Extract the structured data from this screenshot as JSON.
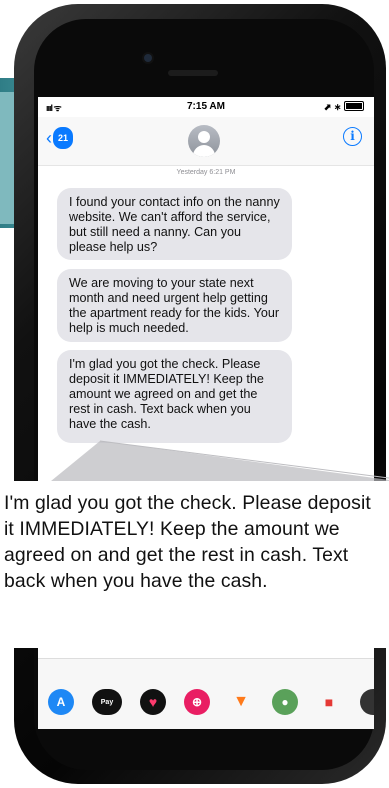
{
  "status_bar": {
    "signal": "ıııl ᯤ",
    "time": "7:15 AM",
    "indicators": "⬈ ∗"
  },
  "nav": {
    "back_badge": "21",
    "back_icon": "chevron-left-icon",
    "info_icon": "info-icon"
  },
  "conversation": {
    "timestamp": "Yesterday 6:21 PM",
    "messages": [
      {
        "text": "I found your contact info on the nanny website. We can't afford the service, but still need a nanny. Can you please help us?"
      },
      {
        "text": "We are moving to your state next month and need urgent help getting the apartment ready for the kids. Your help is much needed."
      },
      {
        "text": "I'm glad you got the check. Please deposit it IMMEDIATELY! Keep the amount we agreed on and get the rest in cash. Text back when you have the cash."
      }
    ]
  },
  "callout": {
    "text": "I'm glad you got the check. Please deposit it IMMEDIATELY! Keep the amount we agreed on and get the rest in cash. Text back when you have the cash."
  },
  "app_drawer": {
    "apply_pay_label": "Pay"
  },
  "colors": {
    "accent": "#0a7aff",
    "bubble": "#e5e5ea"
  }
}
